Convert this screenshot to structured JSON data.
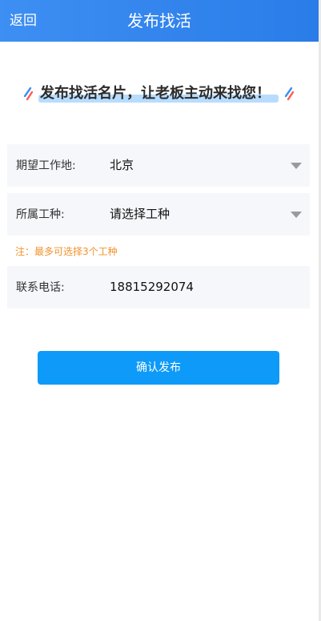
{
  "header": {
    "back_label": "返回",
    "title": "发布找活"
  },
  "slogan": {
    "text": "发布找活名片，让老板主动来找您！"
  },
  "form": {
    "location": {
      "label": "期望工作地:",
      "value": "北京"
    },
    "trade": {
      "label": "所属工种:",
      "value": "请选择工种"
    },
    "note": "注：最多可选择3个工种",
    "phone": {
      "label": "联系电话:",
      "value": "18815292074"
    }
  },
  "actions": {
    "confirm_label": "确认发布"
  },
  "colors": {
    "header_start": "#3d8ff3",
    "header_end": "#2a7ce8",
    "field_bg": "#f6f7fb",
    "note": "#f0932b",
    "button": "#0e9af8",
    "highlight": "#b7dcff"
  }
}
